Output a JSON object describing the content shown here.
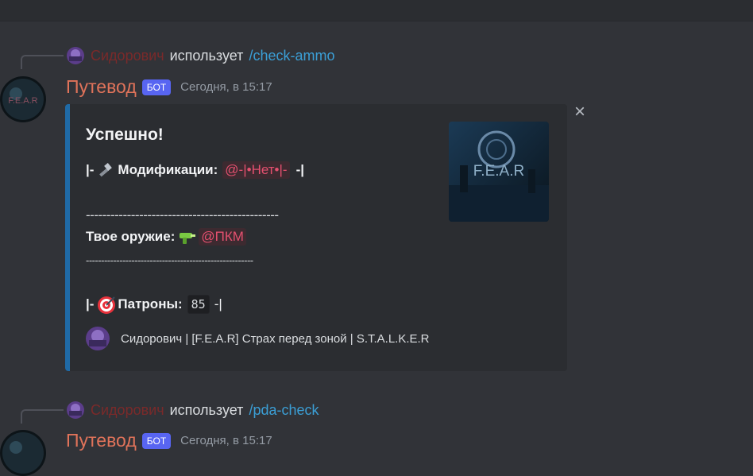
{
  "messages": [
    {
      "reply": {
        "user": "Сидорович",
        "uses": "использует",
        "command": "/check-ammo"
      },
      "author": "Путевод",
      "badge": "БОТ",
      "timestamp": "Сегодня, в 15:17",
      "embed": {
        "title": "Успешно!",
        "mods_prefix": "|-",
        "mods_label": "Модификации:",
        "mods_value": "@-|•Нет•|-",
        "mods_suffix": "-|",
        "separator1": "-----------------------------------------------",
        "weapon_label": "Твое оружие:",
        "weapon_value": "@ПКМ",
        "separator2": "-------------------------------------------------------",
        "ammo_prefix": "|-",
        "ammo_label": "Патроны:",
        "ammo_value": "85",
        "ammo_suffix": "-|",
        "thumbnail_text": "F.E.A.R",
        "footer": "Сидорович | [F.E.A.R] Страх перед зоной | S.T.A.L.K.E.R"
      }
    },
    {
      "reply": {
        "user": "Сидорович",
        "uses": "использует",
        "command": "/pda-check"
      },
      "author": "Путевод",
      "badge": "БОТ",
      "timestamp": "Сегодня, в 15:17"
    }
  ],
  "avatar_text": "F.E.A.R",
  "close_icon": "×",
  "icons": [
    "wrench-icon",
    "raygun-icon",
    "target-icon",
    "close-icon"
  ],
  "colors": {
    "accent_bar": "#1f6aa6",
    "author": "#e0735a",
    "mention": "#e4506f",
    "badge": "#5865f2"
  }
}
